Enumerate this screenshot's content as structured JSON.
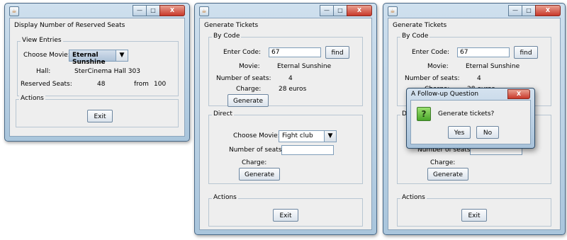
{
  "w1": {
    "title": "Display Number of Reserved Seats",
    "view_entries": {
      "title": "View Entries",
      "choose_movie_label": "Choose Movie:",
      "movie_value": "Eternal Sunshine",
      "hall_label": "Hall:",
      "hall_value": "SterCinema Hall 303",
      "reserved_label": "Reserved Seats:",
      "reserved_value": "48",
      "from_label": "from",
      "from_value": "100"
    },
    "actions": {
      "title": "Actions",
      "exit_label": "Exit"
    }
  },
  "w2": {
    "title": "Generate Tickets",
    "by_code": {
      "title": "By Code",
      "enter_code_label": "Enter Code:",
      "code_value": "67",
      "find_label": "find",
      "movie_label": "Movie:",
      "movie_value": "Eternal Sunshine",
      "seats_label": "Number of seats:",
      "seats_value": "4",
      "charge_label": "Charge:",
      "charge_value": "28 euros",
      "generate_label": "Generate"
    },
    "direct": {
      "title": "Direct",
      "choose_movie_label": "Choose Movie:",
      "movie_value": "Fight club",
      "seats_label": "Number of seats:",
      "seats_value": "",
      "charge_label": "Charge:",
      "generate_label": "Generate"
    },
    "actions": {
      "title": "Actions",
      "exit_label": "Exit"
    }
  },
  "w3": {
    "title": "Generate Tickets",
    "by_code": {
      "title": "By Code",
      "enter_code_label": "Enter Code:",
      "code_value": "67",
      "find_label": "find",
      "movie_label": "Movie:",
      "movie_value": "Eternal Sunshine",
      "seats_label": "Number of seats:",
      "seats_value": "4",
      "charge_label": "Charge:",
      "charge_value": "28 euros"
    },
    "direct": {
      "title_partial": "Di",
      "seats_label": "Number of seats:",
      "charge_label": "Charge:",
      "generate_label": "Generate"
    },
    "actions": {
      "title": "Actions",
      "exit_label": "Exit"
    }
  },
  "dialog": {
    "title": "A Follow-up Question",
    "icon": "?",
    "message": "Generate tickets?",
    "yes_label": "Yes",
    "no_label": "No"
  },
  "window_buttons": {
    "minimize": "—",
    "maximize": "□",
    "close": "X"
  }
}
